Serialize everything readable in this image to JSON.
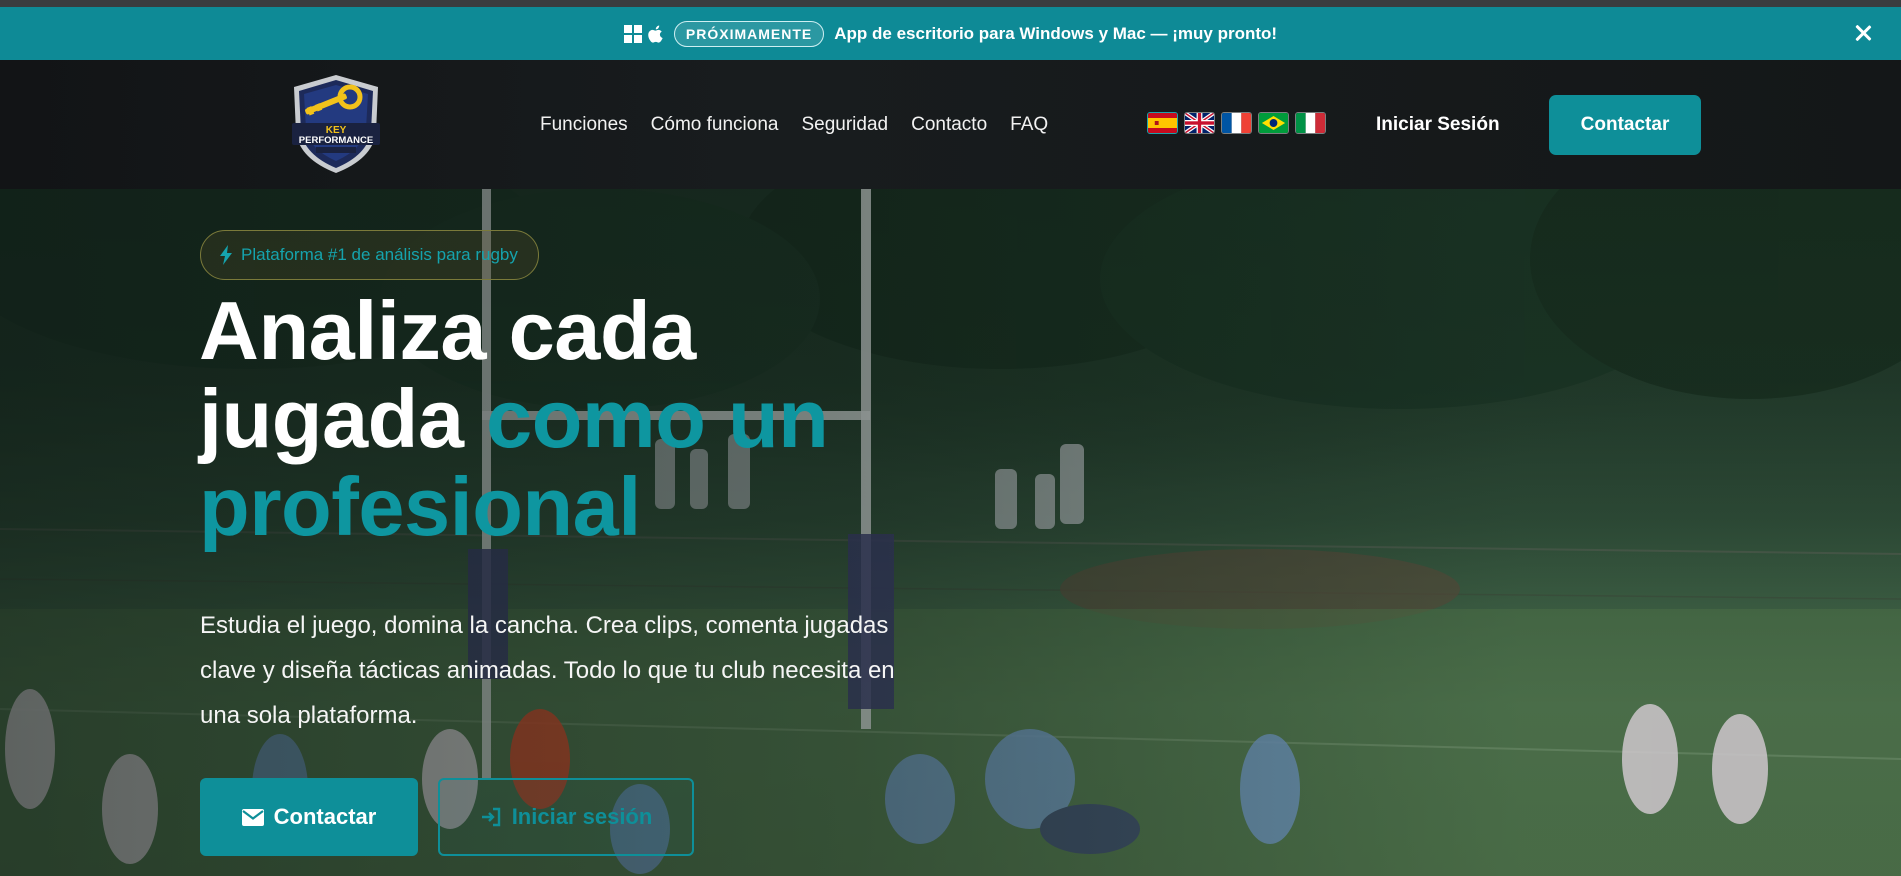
{
  "announcement": {
    "badge": "PRÓXIMAMENTE",
    "text": "App de escritorio para Windows y Mac — ¡muy pronto!",
    "icons": [
      "windows-icon",
      "apple-icon",
      "close-icon"
    ]
  },
  "navbar": {
    "logo_text": "KEY PERFORMANCE",
    "links": [
      "Funciones",
      "Cómo funciona",
      "Seguridad",
      "Contacto",
      "FAQ"
    ],
    "languages": [
      "es",
      "en",
      "fr",
      "pt-br",
      "it"
    ],
    "active_language": "es",
    "login": "Iniciar Sesión",
    "contact": "Contactar"
  },
  "hero": {
    "badge": "Plataforma #1 de análisis para rugby",
    "title_white": "Analiza cada jugada ",
    "title_accent": "como un profesional",
    "description": "Estudia el juego, domina la cancha. Crea clips, comenta jugadas clave y diseña tácticas animadas. Todo lo que tu club necesita en una sola plataforma.",
    "cta_primary": "Contactar",
    "cta_secondary": "Iniciar sesión"
  },
  "colors": {
    "accent": "#0e8f99",
    "announcement_bg": "#0e8a96",
    "navbar_bg": "#16191b"
  }
}
